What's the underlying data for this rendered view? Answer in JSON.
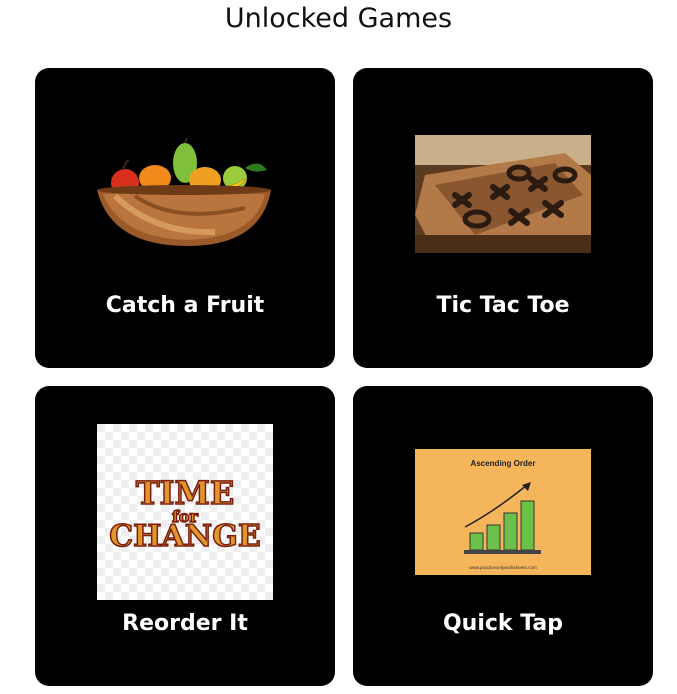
{
  "page": {
    "title": "Unlocked Games"
  },
  "games": [
    {
      "label": "Catch a Fruit",
      "image": "fruit-bowl"
    },
    {
      "label": "Tic Tac Toe",
      "image": "wooden-tic-tac-toe-board"
    },
    {
      "label": "Reorder It",
      "image": "time-for-change-text",
      "image_text": [
        "TIME",
        "for",
        "CHANGE"
      ]
    },
    {
      "label": "Quick Tap",
      "image": "ascending-order-bar-chart",
      "image_text": [
        "Ascending Order",
        "www.practiceonlyworksheets.com"
      ]
    }
  ],
  "colors": {
    "card_bg": "#000000",
    "label": "#ffffff",
    "chart_bg": "#f5b55a",
    "bars": "#6cc04a"
  }
}
